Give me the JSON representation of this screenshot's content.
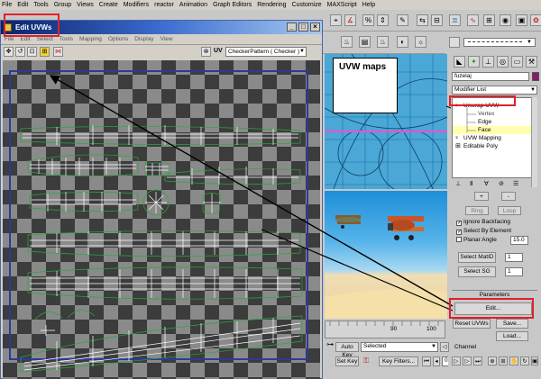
{
  "menubar": {
    "items": [
      "File",
      "Edit",
      "Tools",
      "Group",
      "Views",
      "Create",
      "Modifiers",
      "reactor",
      "Animation",
      "Graph Editors",
      "Rendering",
      "Customize",
      "MAXScript",
      "Help"
    ]
  },
  "uvw_window": {
    "title": "Edit UVWs",
    "menu": [
      "File",
      "Edit",
      "Select",
      "Tools",
      "Mapping",
      "Options",
      "Display",
      "View"
    ],
    "toolbar": {
      "uv_label": "UV",
      "checker_dropdown": "CheckerPattern  ( Checker )"
    }
  },
  "viewport": {
    "annotation": "UVW maps"
  },
  "command_panel": {
    "object_name": "fuzelaj",
    "modifier_list": "Modifier List",
    "stack": {
      "unwrap": "Unwrap UVW",
      "vertex": "Vertex",
      "edge": "Edge",
      "face": "Face",
      "uvw_mapping": "UVW Mapping",
      "editable_poly": "Editable Poly"
    },
    "ring_label": "Ring",
    "loop_label": "Loop",
    "ignore_backfacing": "Ignore Backfacing",
    "select_by_element": "Select By Element",
    "planar_angle": "Planar Angle",
    "planar_angle_value": "15.0",
    "select_matid": "Select MatID",
    "select_sg": "Select SG",
    "spinner_value_1": "1",
    "spinner_value_2": "1",
    "parameters_title": "Parameters",
    "edit_button": "Edit...",
    "reset_uvws": "Reset UVWs",
    "save_button": "Save...",
    "load_button": "Load...",
    "channel_label": "Channel"
  },
  "bottom_bar": {
    "tick_90": "90",
    "tick_100": "100",
    "auto_key": "Auto Key",
    "selected_dropdown": "Selected",
    "set_key": "Set Key",
    "key_filters": "Key Filters...",
    "frame_value": "0"
  },
  "colors": {
    "highlight": "#e0202a",
    "title_bar": "#0a246a",
    "uv_wireframe": "#ffffff",
    "uv_seam": "#2aa83a",
    "active_face": "#ffffb0"
  }
}
